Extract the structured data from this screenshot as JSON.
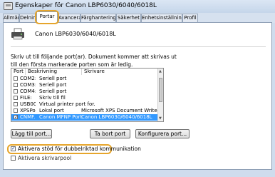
{
  "window": {
    "title": "Egenskaper för Canon LBP6030/6040/6018L"
  },
  "tabs": [
    {
      "label": "Allmänt"
    },
    {
      "label": "Delning"
    },
    {
      "label": "Portar"
    },
    {
      "label": "Avancerat"
    },
    {
      "label": "Färghantering"
    },
    {
      "label": "Säkerhet"
    },
    {
      "label": "Enhetsinställningar"
    },
    {
      "label": "Profil"
    }
  ],
  "printer": {
    "name": "Canon LBP6030/6040/6018L"
  },
  "description": "Skriv ut till följande port(ar). Dokument kommer att skrivas ut till den första markerade porten som är ledig.",
  "ports": {
    "headers": {
      "port": "Port",
      "desc": "Beskrivning",
      "printer": "Skrivare"
    },
    "rows": [
      {
        "port": "COM2:",
        "desc": "Seriell port",
        "printer": "",
        "checked": false,
        "selected": false
      },
      {
        "port": "COM3:",
        "desc": "Seriell port",
        "printer": "",
        "checked": false,
        "selected": false
      },
      {
        "port": "COM4:",
        "desc": "Seriell port",
        "printer": "",
        "checked": false,
        "selected": false
      },
      {
        "port": "FILE:",
        "desc": "Skriv till fil",
        "printer": "",
        "checked": false,
        "selected": false
      },
      {
        "port": "USB001",
        "desc": "Virtual printer port for...",
        "printer": "",
        "checked": false,
        "selected": false
      },
      {
        "port": "XPSPort:",
        "desc": "Lokal port",
        "printer": "Microsoft XPS Document Writer",
        "checked": false,
        "selected": false
      },
      {
        "port": "CNMF...",
        "desc": "Canon MFNP Port",
        "printer": "Canon LBP6030/6040/6018L",
        "checked": true,
        "selected": true
      }
    ]
  },
  "buttons": {
    "add": "Lägg till port...",
    "delete": "Ta bort port",
    "configure": "Konfigurera port..."
  },
  "options": {
    "bidirectional": {
      "label": "Aktivera stöd för dubbelriktad kommunikation",
      "checked": true
    },
    "pool": {
      "label": "Aktivera skrivarpool",
      "checked": false
    }
  },
  "colors": {
    "highlight": "#e6a52b",
    "selection": "#3399ff"
  }
}
